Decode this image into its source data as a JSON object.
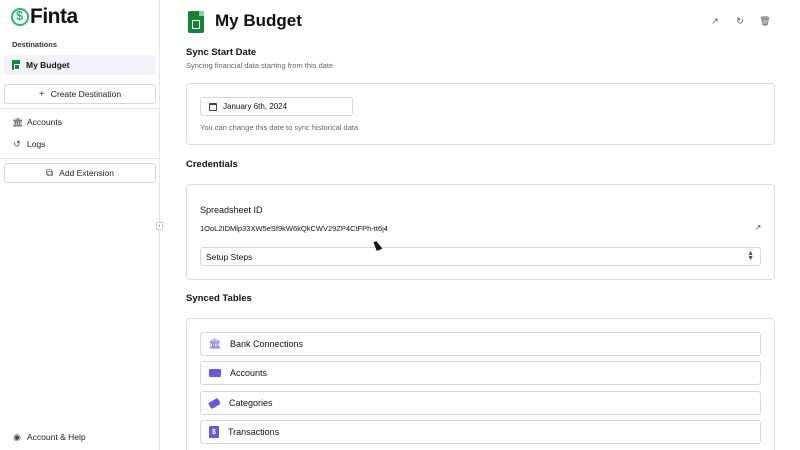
{
  "app": {
    "logo_text": "Finta"
  },
  "sidebar": {
    "section_label": "Destinations",
    "active_item": {
      "label": "My Budget",
      "icon": "google-sheets-icon"
    },
    "create_button": {
      "label": "Create Destination",
      "icon": "plus-icon"
    },
    "items": [
      {
        "label": "Accounts",
        "icon": "bank-icon"
      },
      {
        "label": "Logs",
        "icon": "history-icon"
      }
    ],
    "add_extension": {
      "label": "Add Extension",
      "icon": "extension-icon"
    },
    "footer": {
      "label": "Account & Help",
      "icon": "user-circle-icon"
    }
  },
  "header": {
    "title": "My Budget",
    "actions": [
      {
        "name": "open-external-button",
        "glyph": "↗"
      },
      {
        "name": "sync-button",
        "glyph": "↻"
      },
      {
        "name": "delete-button",
        "glyph": "🗑"
      }
    ]
  },
  "sync": {
    "title": "Sync Start Date",
    "subtitle": "Syncing financial data starting from this date",
    "date_value": "January 6th, 2024",
    "hint": "You can change this date to sync historical data"
  },
  "credentials": {
    "title": "Credentials",
    "spreadsheet_label": "Spreadsheet ID",
    "spreadsheet_id": "1OoL2IDMlp33XW5eSf9kW6kQkCWV29ZP4CtFPh-tt6j4",
    "setup_select": "Setup Steps"
  },
  "synced_tables": {
    "title": "Synced Tables",
    "rows": [
      {
        "label": "Bank Connections",
        "icon": "bank-icon"
      },
      {
        "label": "Accounts",
        "icon": "credit-card-icon"
      },
      {
        "label": "Categories",
        "icon": "tag-icon"
      },
      {
        "label": "Transactions",
        "icon": "receipt-icon"
      }
    ]
  },
  "colors": {
    "accent": "#6b5bd3",
    "sheets_green": "#188038",
    "logo_green": "#2bb673"
  }
}
